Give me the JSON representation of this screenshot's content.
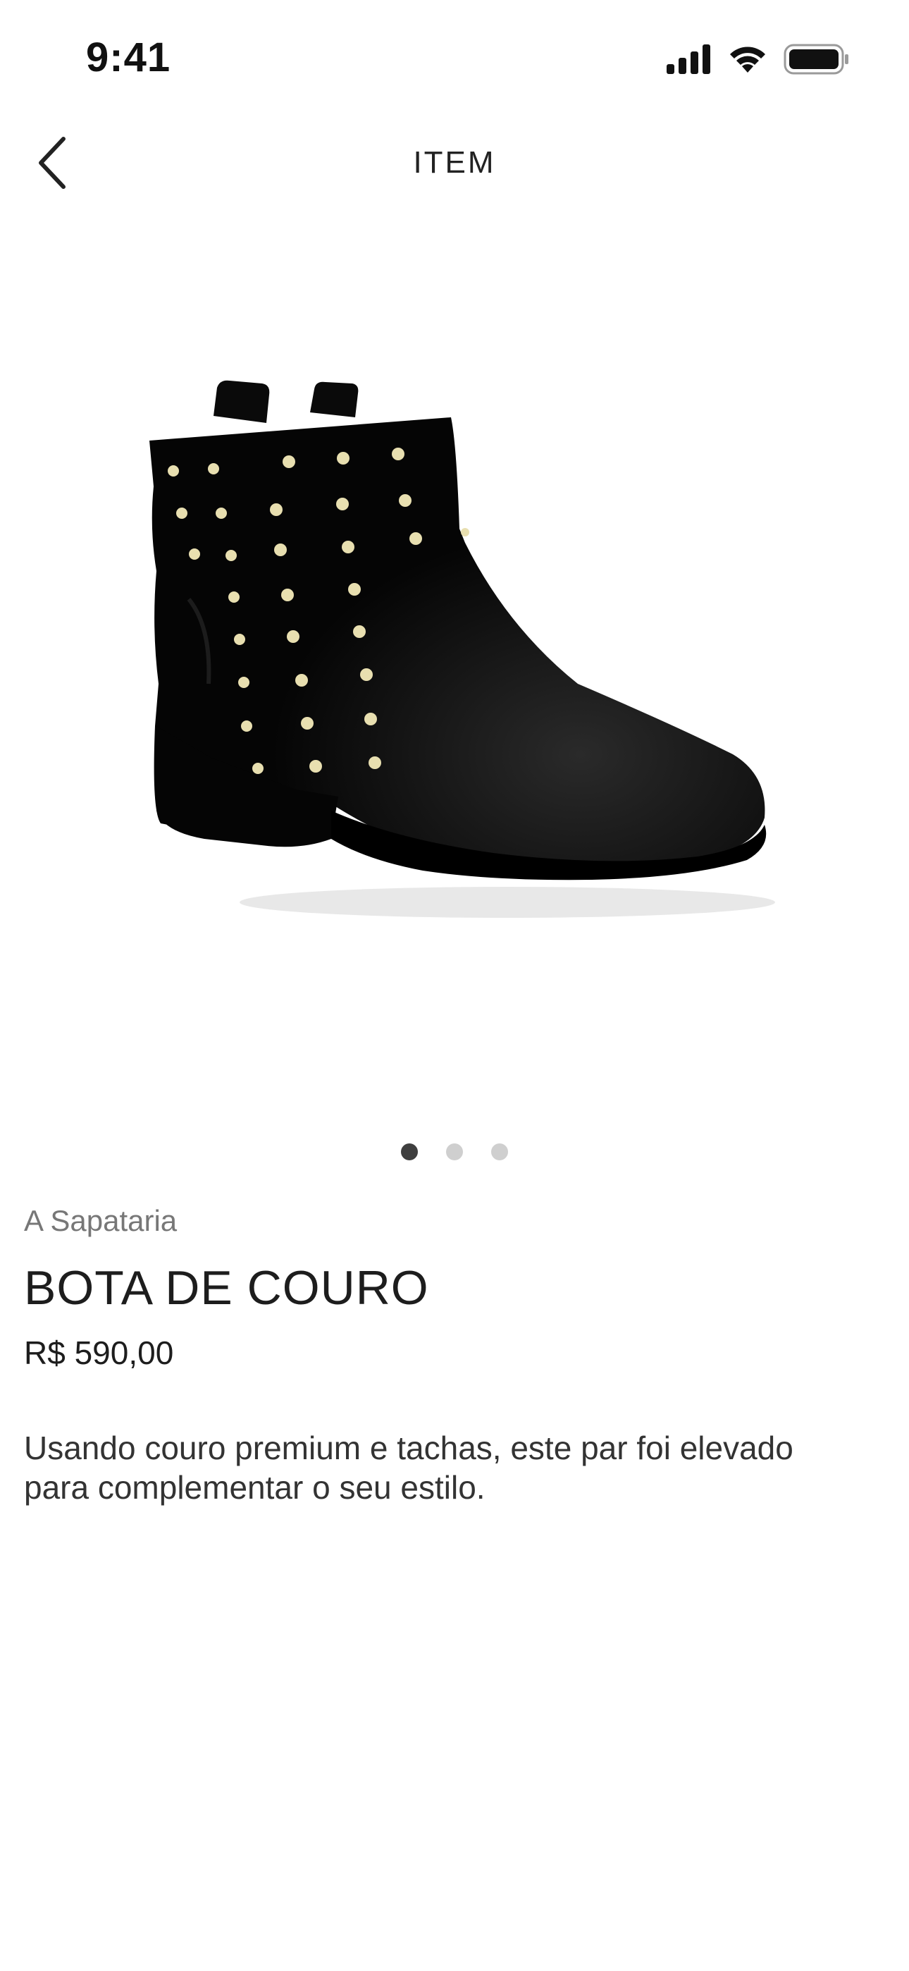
{
  "status_bar": {
    "time": "9:41",
    "icons": [
      "cellular-signal-icon",
      "wifi-icon",
      "battery-icon"
    ]
  },
  "nav": {
    "back_icon": "chevron-left-icon",
    "title": "ITEM"
  },
  "carousel": {
    "image_subject": "boot-product-image",
    "page_count": 3,
    "active_index": 0
  },
  "product": {
    "brand": "A Sapataria",
    "name": "BOTA DE COURO",
    "price": "R$ 590,00",
    "description": "Usando couro premium e tachas, este par foi elevado para complementar o seu estilo."
  },
  "colors": {
    "background": "#ffffff",
    "text_primary": "#1d1d1d",
    "text_secondary": "#777777",
    "dot_active": "#3f3f3f",
    "dot_inactive": "#cfcfcf",
    "stud_gold": "#e8dfb0"
  }
}
